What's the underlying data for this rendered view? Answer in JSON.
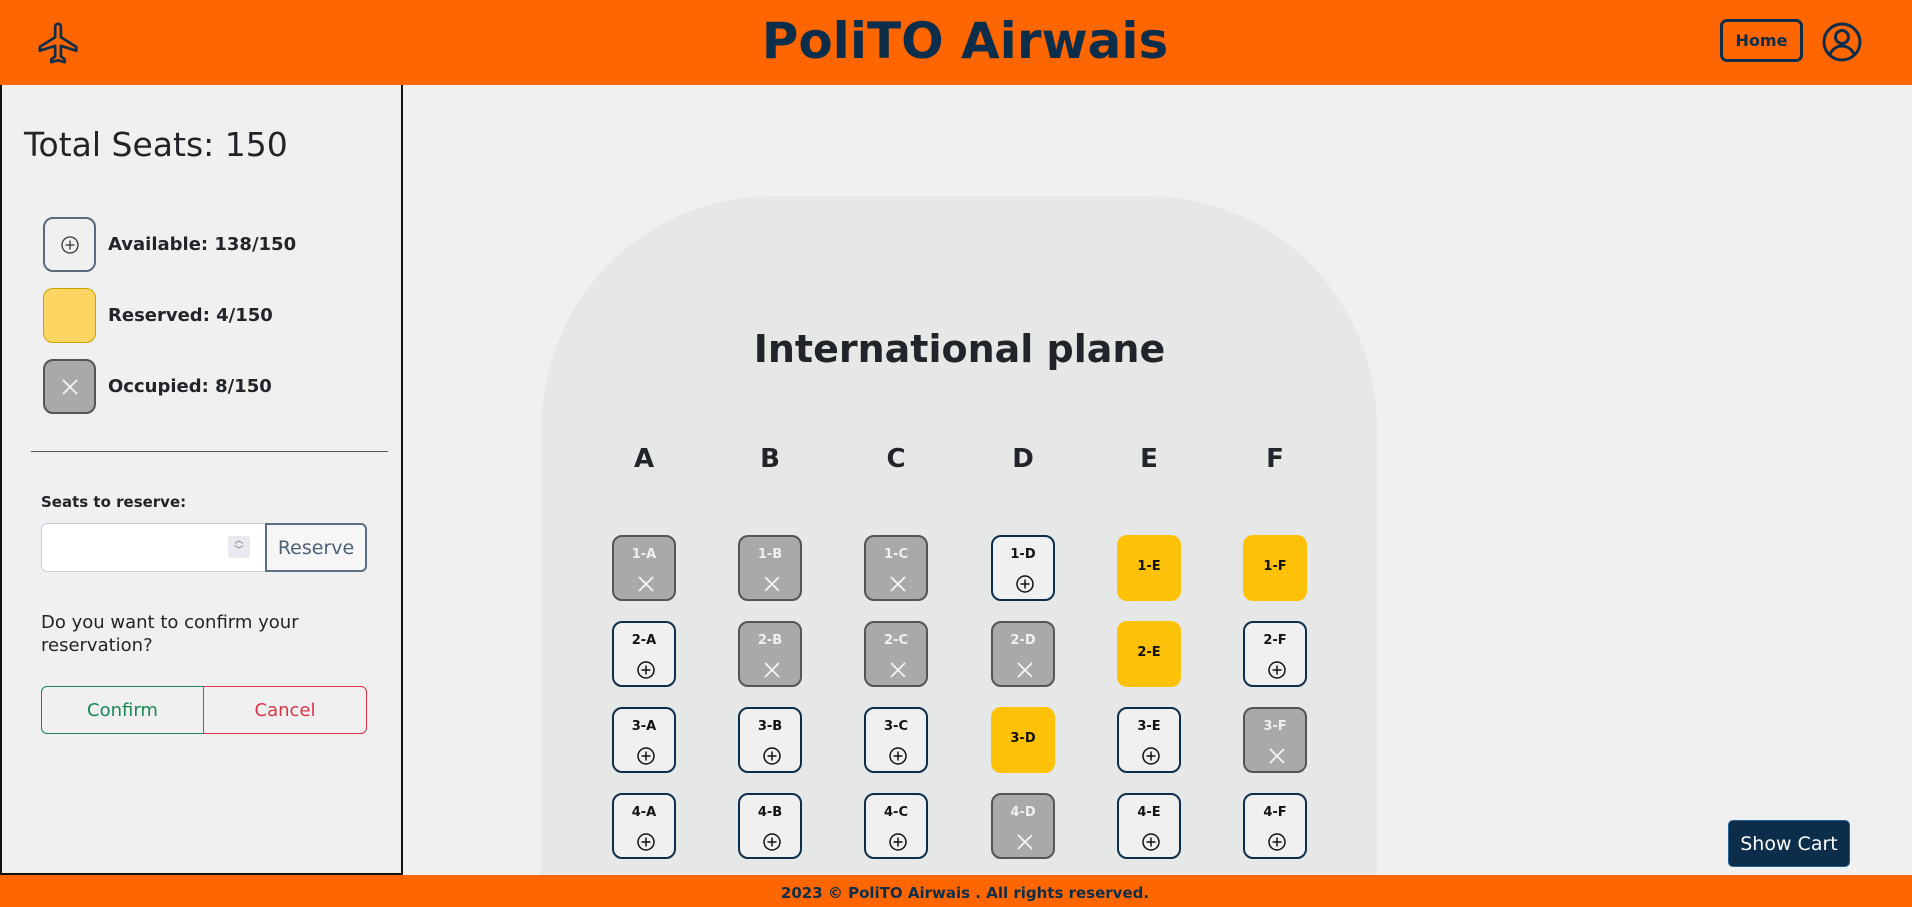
{
  "header": {
    "title": "PoliTO Airwais",
    "home_label": "Home",
    "logo_icon": "airplane-icon",
    "profile_icon": "user-circle-icon"
  },
  "sidebar": {
    "total_seats": "Total Seats: 150",
    "legend": [
      {
        "type": "available",
        "label": "Available: 138/150",
        "icon": "plus-circle-icon"
      },
      {
        "type": "reserved",
        "label": "Reserved: 4/150",
        "icon": ""
      },
      {
        "type": "occupied",
        "label": "Occupied: 8/150",
        "icon": "x-icon"
      }
    ],
    "seats_to_reserve_label": "Seats to reserve:",
    "seats_input_value": "",
    "reserve_label": "Reserve",
    "confirm_question": "Do you want to confirm your reservation?",
    "confirm_label": "Confirm",
    "cancel_label": "Cancel"
  },
  "plane": {
    "title": "International plane",
    "columns": [
      "A",
      "B",
      "C",
      "D",
      "E",
      "F"
    ],
    "rows": [
      [
        {
          "label": "1-A",
          "status": "occupied"
        },
        {
          "label": "1-B",
          "status": "occupied"
        },
        {
          "label": "1-C",
          "status": "occupied"
        },
        {
          "label": "1-D",
          "status": "available"
        },
        {
          "label": "1-E",
          "status": "reserved"
        },
        {
          "label": "1-F",
          "status": "reserved"
        }
      ],
      [
        {
          "label": "2-A",
          "status": "available"
        },
        {
          "label": "2-B",
          "status": "occupied"
        },
        {
          "label": "2-C",
          "status": "occupied"
        },
        {
          "label": "2-D",
          "status": "occupied"
        },
        {
          "label": "2-E",
          "status": "reserved"
        },
        {
          "label": "2-F",
          "status": "available"
        }
      ],
      [
        {
          "label": "3-A",
          "status": "available"
        },
        {
          "label": "3-B",
          "status": "available"
        },
        {
          "label": "3-C",
          "status": "available"
        },
        {
          "label": "3-D",
          "status": "reserved"
        },
        {
          "label": "3-E",
          "status": "available"
        },
        {
          "label": "3-F",
          "status": "occupied"
        }
      ],
      [
        {
          "label": "4-A",
          "status": "available"
        },
        {
          "label": "4-B",
          "status": "available"
        },
        {
          "label": "4-C",
          "status": "available"
        },
        {
          "label": "4-D",
          "status": "occupied"
        },
        {
          "label": "4-E",
          "status": "available"
        },
        {
          "label": "4-F",
          "status": "available"
        }
      ]
    ]
  },
  "cart": {
    "label": "Show Cart"
  },
  "footer": {
    "text": "2023 © PoliTO Airwais . All rights reserved."
  },
  "colors": {
    "header_bg": "#ff6600",
    "navy": "#0c2e4a",
    "reserved": "#fdc107",
    "occupied": "#a9a9a9",
    "confirm": "#198754",
    "cancel": "#dc3545"
  }
}
